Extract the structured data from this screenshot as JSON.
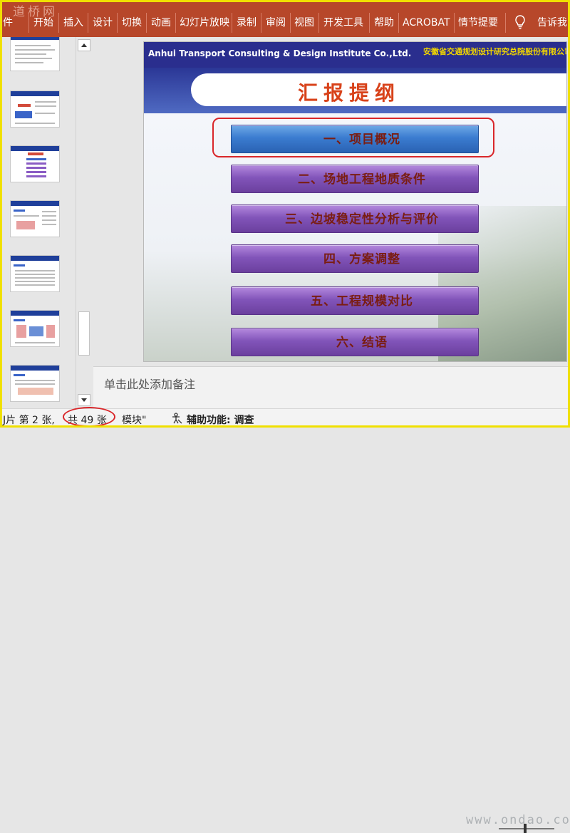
{
  "ribbon": {
    "watermark": "道桥网",
    "tabs": [
      "件",
      "开始",
      "插入",
      "设计",
      "切换",
      "动画",
      "幻灯片放映",
      "录制",
      "审阅",
      "视图",
      "开发工具",
      "帮助",
      "ACROBAT",
      "情节提要"
    ],
    "tell_me": "告诉我",
    "bg_color": "#b7472a"
  },
  "thumbnails": {
    "count_visible": 7
  },
  "slide": {
    "header_en": "Anhui Transport Consulting & Design Institute Co.,Ltd.",
    "header_cn": "安徽省交通规划设计研究总院股份有限公司",
    "title": "汇报提纲",
    "items": [
      "一、项目概况",
      "二、场地工程地质条件",
      "三、边坡稳定性分析与评价",
      "四、方案调整",
      "五、工程规模对比",
      "六、结语"
    ],
    "selected_index": 0
  },
  "notes": {
    "placeholder": "单击此处添加备注"
  },
  "status": {
    "slide_pos": "J片 第 2 张,",
    "slide_total": "共 49 张",
    "theme": "模块\"",
    "accessibility": "辅助功能: 调查",
    "watermark": "www.ondao.com"
  }
}
